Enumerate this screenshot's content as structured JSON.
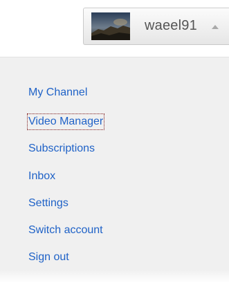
{
  "account": {
    "username": "waeel91",
    "avatar_icon": "profile-photo",
    "caret_icon": "caret-up-icon"
  },
  "menu": {
    "items": [
      {
        "label": "My Channel"
      },
      {
        "label": "Video Manager"
      },
      {
        "label": "Subscriptions"
      },
      {
        "label": "Inbox"
      },
      {
        "label": "Settings"
      },
      {
        "label": "Switch account"
      },
      {
        "label": "Sign out"
      }
    ]
  },
  "colors": {
    "link": "#1f62c7",
    "panel": "#f0f0f0",
    "username": "#555555"
  }
}
